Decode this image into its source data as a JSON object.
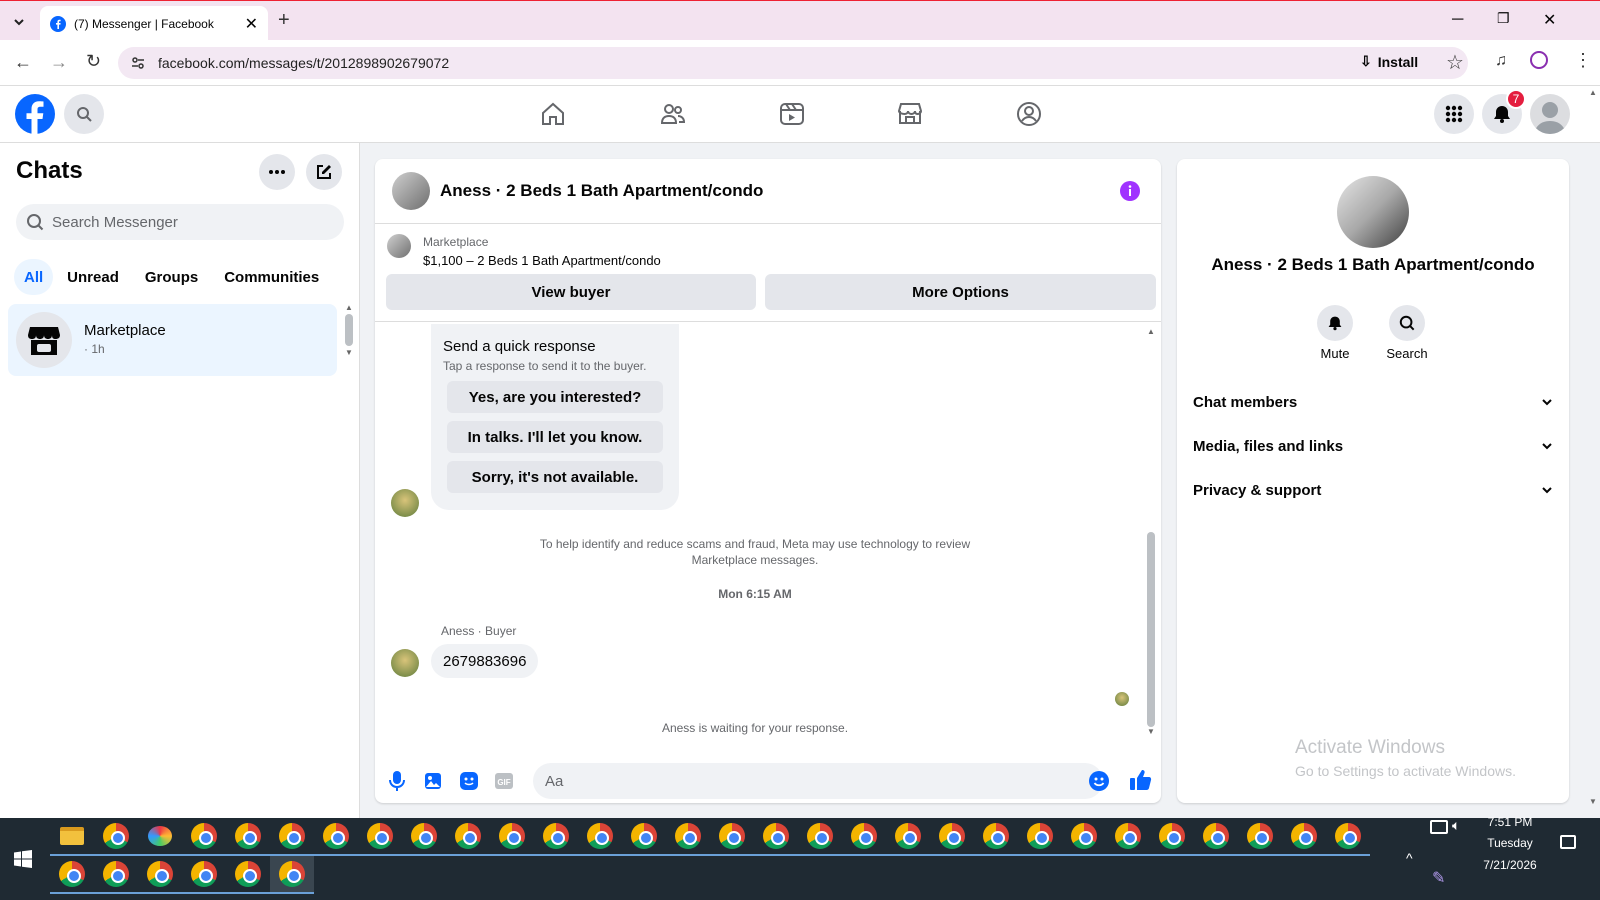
{
  "browser": {
    "tab_title": "(7) Messenger | Facebook",
    "url": "facebook.com/messages/t/2012898902679072",
    "install_label": "Install"
  },
  "fb": {
    "notification_count": "7"
  },
  "chats": {
    "title": "Chats",
    "search_placeholder": "Search Messenger",
    "filters": [
      "All",
      "Unread",
      "Groups",
      "Communities"
    ],
    "items": [
      {
        "name": "Marketplace",
        "time": "· 1h"
      }
    ]
  },
  "conversation": {
    "title": "Aness · 2 Beds 1 Bath Apartment/condo",
    "listing_source": "Marketplace",
    "listing_detail": "$1,100 – 2 Beds 1 Bath Apartment/condo",
    "view_buyer": "View buyer",
    "more_options": "More Options",
    "quick_title": "Send a quick response",
    "quick_sub": "Tap a response to send it to the buyer.",
    "quick_responses": [
      "Yes, are you interested?",
      "In talks. I'll let you know.",
      "Sorry, it's not available."
    ],
    "notice": "To help identify and reduce scams and fraud, Meta may use technology to review Marketplace messages.",
    "timestamp": "Mon 6:15 AM",
    "sender": "Aness · Buyer",
    "message": "2679883696",
    "waiting": "Aness is waiting for your response.",
    "composer_placeholder": "Aa"
  },
  "details": {
    "title": "Aness · 2 Beds 1 Bath Apartment/condo",
    "mute": "Mute",
    "search": "Search",
    "sections": [
      "Chat members",
      "Media, files and links",
      "Privacy & support"
    ]
  },
  "watermark": {
    "line1": "Activate Windows",
    "line2": "Go to Settings to activate Windows."
  },
  "clock": {
    "time": "7:51 PM",
    "day": "Tuesday",
    "date": "7/21/2026"
  },
  "colors": {
    "accent": "#0866ff",
    "info": "#a033ff",
    "badge": "#e41e3f"
  }
}
